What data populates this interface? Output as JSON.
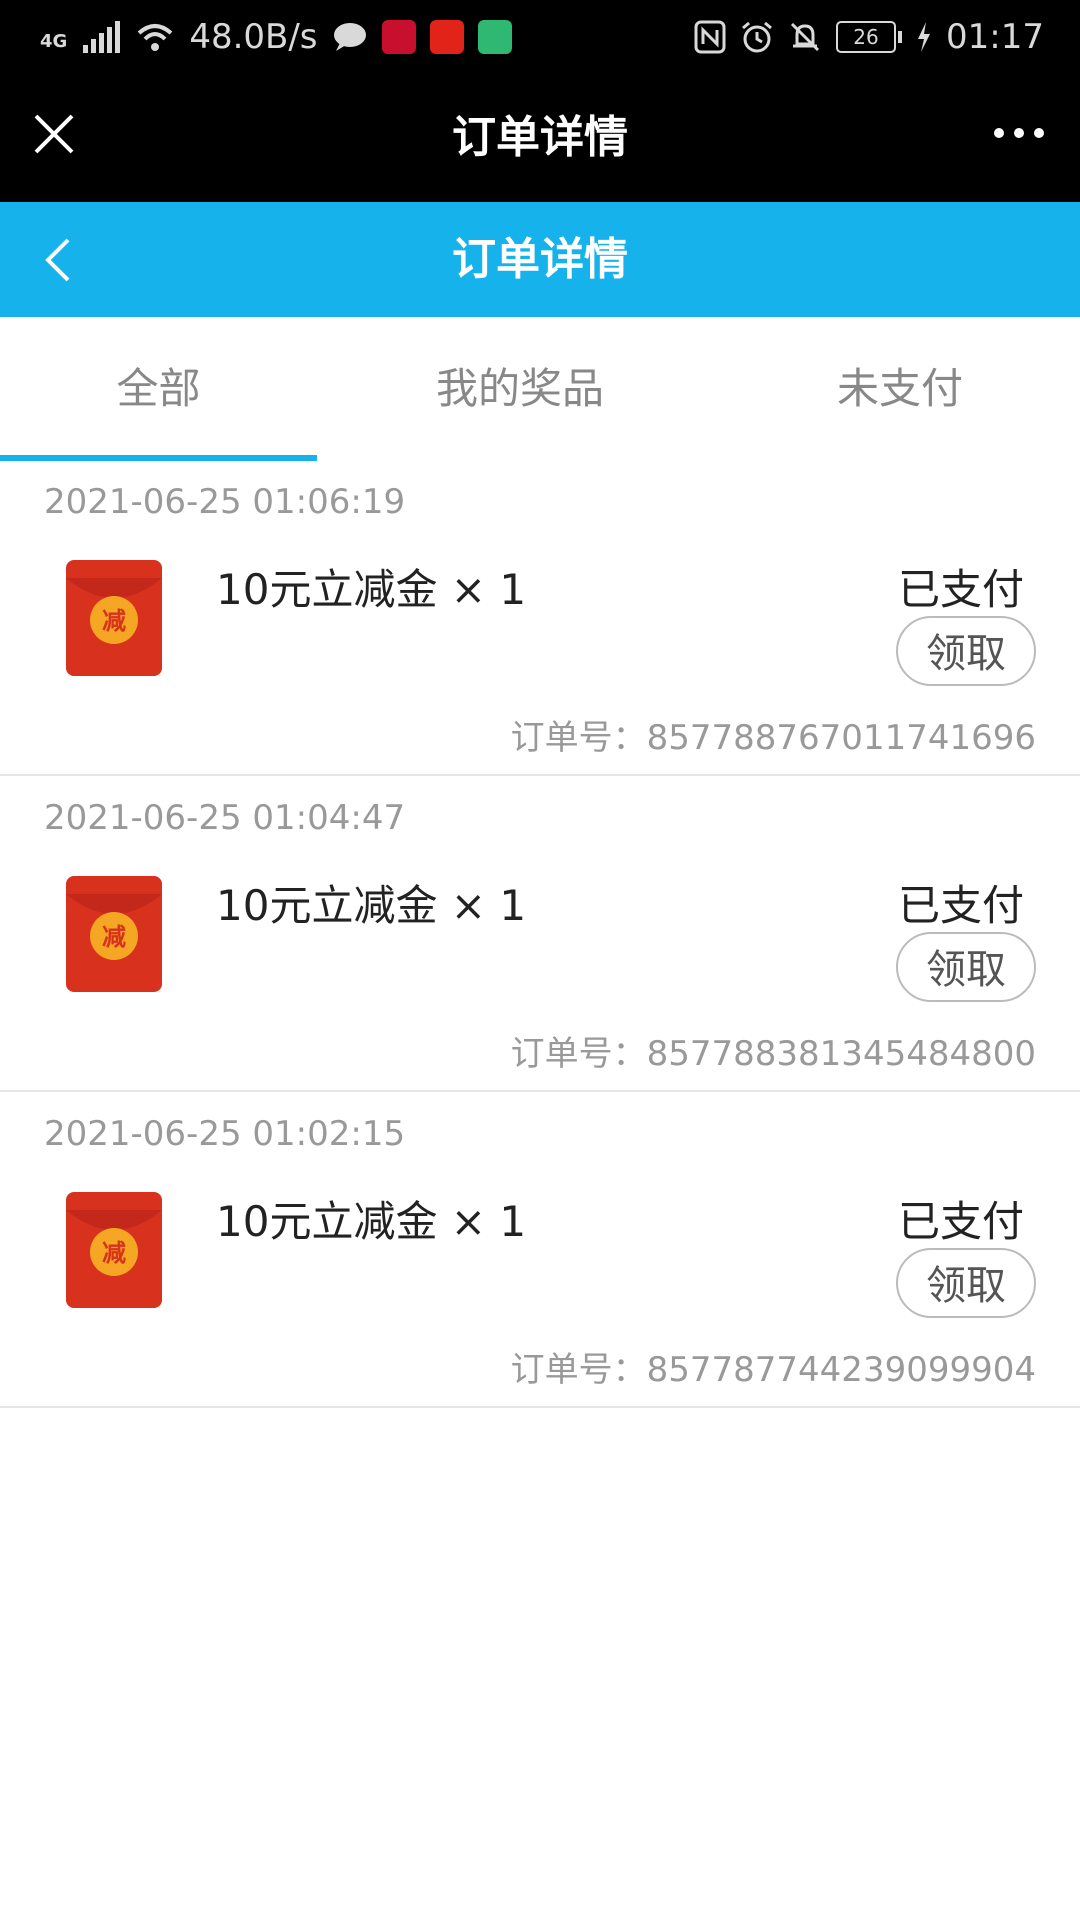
{
  "status_bar": {
    "network": "4G",
    "speed": "48.0B/s",
    "battery": "26",
    "time": "01:17"
  },
  "header": {
    "title": "订单详情"
  },
  "nav": {
    "title": "订单详情"
  },
  "tabs": [
    {
      "label": "全部",
      "active": true
    },
    {
      "label": "我的奖品",
      "active": false
    },
    {
      "label": "未支付",
      "active": false
    }
  ],
  "orders": [
    {
      "time": "2021-06-25 01:06:19",
      "name": "10元立减金 × 1",
      "status": "已支付",
      "button": "领取",
      "order_no": "订单号：857788767011741696"
    },
    {
      "time": "2021-06-25 01:04:47",
      "name": "10元立减金 × 1",
      "status": "已支付",
      "button": "领取",
      "order_no": "订单号：857788381345484800"
    },
    {
      "time": "2021-06-25 01:02:15",
      "name": "10元立减金 × 1",
      "status": "已支付",
      "button": "领取",
      "order_no": "订单号：857787744239099904"
    }
  ],
  "icon_text": "减",
  "colors": {
    "accent": "#16b2ec",
    "icon_red": "#d8321f",
    "icon_gold": "#f5a623"
  }
}
